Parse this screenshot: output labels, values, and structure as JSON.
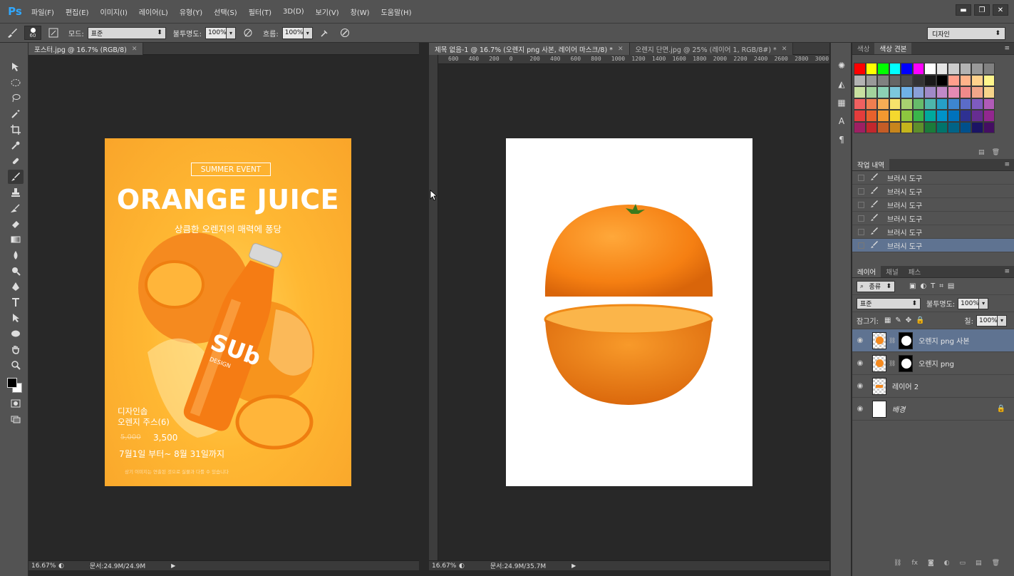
{
  "app": {
    "logo": "Ps",
    "menu": [
      "파일(F)",
      "편집(E)",
      "이미지(I)",
      "레이어(L)",
      "유형(Y)",
      "선택(S)",
      "필터(T)",
      "3D(D)",
      "보기(V)",
      "창(W)",
      "도움말(H)"
    ],
    "window_buttons": [
      "▬",
      "❐",
      "✕"
    ]
  },
  "options": {
    "brush_size": "60",
    "mode_label": "모드:",
    "mode_value": "표준",
    "opacity_label": "불투명도:",
    "opacity_value": "100%",
    "flow_label": "흐름:",
    "flow_value": "100%",
    "workspace": "디자인"
  },
  "doc_left": {
    "tab": "포스터.jpg @ 16.7% (RGB/8)",
    "zoom": "16.67%",
    "info": "문서:24.9M/24.9M"
  },
  "doc_right": {
    "tabs": [
      "제목 없음-1 @ 16.7% (오렌지 png 사본, 레이어 마스크/8) *",
      "오렌지 단면.jpg @ 25% (레이어 1, RGB/8#) *"
    ],
    "zoom": "16.67%",
    "info": "문서:24.9M/35.7M",
    "ruler_labels": [
      "600",
      "400",
      "200",
      "0",
      "200",
      "400",
      "600",
      "800",
      "1000",
      "1200",
      "1400",
      "1600",
      "1800",
      "2000",
      "2200",
      "2400",
      "2600",
      "2800",
      "3000"
    ]
  },
  "poster": {
    "badge": "SUMMER EVENT",
    "title": "ORANGE JUICE",
    "subtitle": "상큼한 오렌지의 매력에 퐁당",
    "bottle_brand": "SUb",
    "bottle_sub": "DESIGN",
    "line1": "디자인솝",
    "line2": "오렌지 주스(6)",
    "old_price": "5,000",
    "price": "3,500",
    "date": "7월1일 부터~ 8월 31일까지",
    "fine_print": "상기 이미지는 연출된 것으로 실물과 다를 수 있습니다"
  },
  "swatches_panel": {
    "tabs": [
      "색상",
      "색상 견본"
    ],
    "colors": [
      "#ff0000",
      "#ffff00",
      "#00ff00",
      "#00ffff",
      "#0000ff",
      "#ff00ff",
      "#ffffff",
      "#e6e6e6",
      "#cccccc",
      "#b3b3b3",
      "#999999",
      "#808080",
      "#b3b3b3",
      "#999999",
      "#808080",
      "#666666",
      "#4d4d4d",
      "#333333",
      "#1a1a1a",
      "#000000",
      "#ff9f8c",
      "#ffb38a",
      "#ffd28c",
      "#fff58c",
      "#c8e0a0",
      "#a3d39c",
      "#8bd0b4",
      "#7cc8dc",
      "#6fb1e6",
      "#8aa0d8",
      "#a08ac8",
      "#c08ac8",
      "#e48ab4",
      "#f08a8a",
      "#f0a68a",
      "#f6d48a",
      "#f06060",
      "#f07e50",
      "#f6ad55",
      "#f7e26b",
      "#a8d070",
      "#66bb6a",
      "#4db6ac",
      "#26a0c8",
      "#3d86d0",
      "#5b6cc8",
      "#7e5bc0",
      "#b05bb8",
      "#e43c3c",
      "#e8612c",
      "#f29830",
      "#f4d82e",
      "#8dc63f",
      "#39b54a",
      "#00a99d",
      "#0093c9",
      "#0072bc",
      "#2e3192",
      "#662d91",
      "#92278f",
      "#9e1f63",
      "#c1272d",
      "#c45c26",
      "#c7851c",
      "#c4b51c",
      "#5f8f2c",
      "#1b7b3a",
      "#00746b",
      "#006387",
      "#00508c",
      "#1b1464",
      "#440e62"
    ],
    "footer": [
      "▤",
      "🗑"
    ]
  },
  "history_panel": {
    "tabs": [
      "작업 내역"
    ],
    "items": [
      "브러시 도구",
      "브러시 도구",
      "브러시 도구",
      "브러시 도구",
      "브러시 도구",
      "브러시 도구"
    ],
    "active_index": 5
  },
  "layers_panel": {
    "tabs": [
      "레이어",
      "채널",
      "패스"
    ],
    "filter_label": "종류",
    "blend_mode": "표준",
    "opacity_label": "불투명도:",
    "opacity_value": "100%",
    "lock_label": "잠그기:",
    "fill_label": "칠:",
    "fill_value": "100%",
    "layers": [
      {
        "name": "오렌지 png 사본",
        "active": true,
        "mask": true
      },
      {
        "name": "오렌지 png",
        "active": false,
        "mask": true
      },
      {
        "name": "레이어 2",
        "active": false,
        "mask": false
      },
      {
        "name": "배경",
        "active": false,
        "mask": false,
        "locked": true
      }
    ]
  },
  "colors": {
    "accent": "#31a8ff",
    "selection": "#5f7391",
    "orange": "#f7941d"
  }
}
